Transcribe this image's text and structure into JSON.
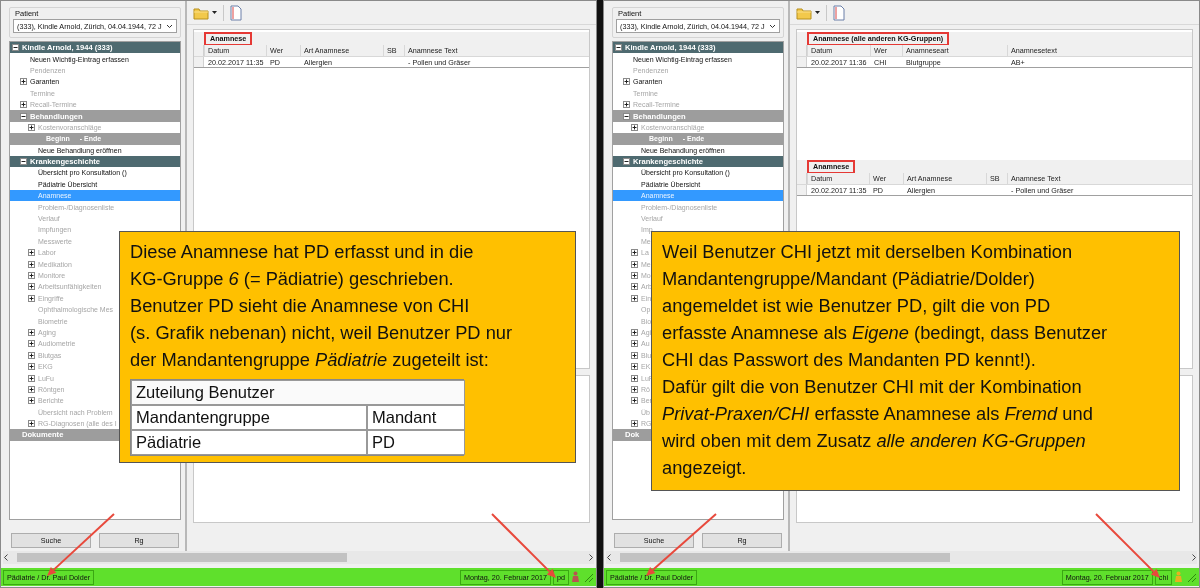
{
  "panels": [
    {
      "patient": {
        "label": "Patient",
        "value": "(333), Kindle Arnold, Zürich, 04.04.1944, 72 J"
      },
      "tree": [
        {
          "kind": "header",
          "label": "Kindle Arnold, 1944 (333)",
          "expanded": true,
          "children": [
            {
              "kind": "item",
              "label": "Neuen Wichtig-Eintrag erfassen",
              "disabled": false,
              "selected": false
            },
            {
              "kind": "item",
              "label": "Pendenzen",
              "disabled": true,
              "selected": false
            },
            {
              "kind": "item",
              "label": "Garanten",
              "disabled": false,
              "selected": false,
              "expanded": false
            },
            {
              "kind": "item",
              "label": "Termine",
              "disabled": true,
              "selected": false
            },
            {
              "kind": "item",
              "label": "Recall-Termine",
              "disabled": true,
              "selected": false,
              "expanded": false
            },
            {
              "kind": "section",
              "label": "Behandlungen",
              "expanded": true,
              "children": [
                {
                  "kind": "item",
                  "label": "Kostenvoranschläge",
                  "disabled": true,
                  "selected": false,
                  "expanded": false
                },
                {
                  "kind": "band",
                  "labels": [
                    "Beginn",
                    "- Ende"
                  ]
                },
                {
                  "kind": "item",
                  "label": "Neue Behandlung eröffnen",
                  "disabled": false,
                  "selected": false
                }
              ]
            },
            {
              "kind": "header",
              "label": "Krankengeschichte",
              "expanded": true,
              "children": [
                {
                  "kind": "item",
                  "label": "Übersicht pro Konsultation ()",
                  "disabled": false,
                  "selected": false
                },
                {
                  "kind": "item",
                  "label": "Pädiatrie Übersicht",
                  "disabled": false,
                  "selected": false
                },
                {
                  "kind": "item",
                  "label": "Anamnese",
                  "disabled": false,
                  "selected": true
                },
                {
                  "kind": "item",
                  "label": "Problem-/Diagnosenliste",
                  "disabled": true,
                  "selected": false
                },
                {
                  "kind": "item",
                  "label": "Verlauf",
                  "disabled": true,
                  "selected": false
                },
                {
                  "kind": "item",
                  "label": "Impfungen",
                  "disabled": true,
                  "selected": false
                },
                {
                  "kind": "item",
                  "label": "Messwerte",
                  "disabled": true,
                  "selected": false
                },
                {
                  "kind": "item",
                  "label": "Labor",
                  "disabled": true,
                  "selected": false,
                  "expanded": false
                },
                {
                  "kind": "item",
                  "label": "Medikation",
                  "disabled": true,
                  "selected": false,
                  "expanded": false
                },
                {
                  "kind": "item",
                  "label": "Monitore",
                  "disabled": true,
                  "selected": false,
                  "expanded": false
                },
                {
                  "kind": "item",
                  "label": "Arbeitsunfähigkeiten",
                  "disabled": true,
                  "selected": false,
                  "expanded": false
                },
                {
                  "kind": "item",
                  "label": "Eingriffe",
                  "disabled": true,
                  "selected": false,
                  "expanded": false
                },
                {
                  "kind": "item",
                  "label": "Ophthalmologische Mes",
                  "disabled": true,
                  "selected": false
                },
                {
                  "kind": "item",
                  "label": "Biometrie",
                  "disabled": true,
                  "selected": false
                },
                {
                  "kind": "item",
                  "label": "Aging",
                  "disabled": true,
                  "selected": false,
                  "expanded": false
                },
                {
                  "kind": "item",
                  "label": "Audiometrie",
                  "disabled": true,
                  "selected": false,
                  "expanded": false
                },
                {
                  "kind": "item",
                  "label": "Blutgas",
                  "disabled": true,
                  "selected": false,
                  "expanded": false
                },
                {
                  "kind": "item",
                  "label": "EKG",
                  "disabled": true,
                  "selected": false,
                  "expanded": false
                },
                {
                  "kind": "item",
                  "label": "LuFu",
                  "disabled": true,
                  "selected": false,
                  "expanded": false
                },
                {
                  "kind": "item",
                  "label": "Röntgen",
                  "disabled": true,
                  "selected": false,
                  "expanded": false
                },
                {
                  "kind": "item",
                  "label": "Berichte",
                  "disabled": true,
                  "selected": false,
                  "expanded": false
                },
                {
                  "kind": "item",
                  "label": "Übersicht nach Problem",
                  "disabled": true,
                  "selected": false
                },
                {
                  "kind": "item",
                  "label": "RG-Diagnosen (alle des I",
                  "disabled": true,
                  "selected": false,
                  "expanded": false
                }
              ]
            }
          ]
        },
        {
          "kind": "section",
          "label": "Dokumente"
        }
      ],
      "buttons": [
        "Suche",
        "Rg"
      ],
      "tables": [
        {
          "caption": "Anamnese",
          "highlighted": true,
          "columns": [
            "Datum",
            "Wer",
            "Art Anamnese",
            "SB",
            "Anamnese Text"
          ],
          "rows": [
            [
              "20.02.2017 11:35",
              "PD",
              "Allergien",
              "",
              "- Pollen und Gräser"
            ]
          ]
        }
      ],
      "status_bar": {
        "text": "Pädiatrie / Dr. Paul Dolder",
        "date": "Montag, 20. Februar 2017",
        "user": "pd",
        "icon": {
          "color": "#b85450"
        }
      },
      "callout": {
        "text": "Diese Anamnese hat PD erfasst und in die\nKG-Gruppe *6* (= Pädiatrie) geschrieben.\nBenutzer PD sieht die Anamnese von CHI\n(s. Grafik nebenan) nicht, weil Benutzer PD nur\nder Mandantengruppe *Pädiatrie* zugeteilt ist:",
        "table": {
          "title": "Zuteilung Benutzer",
          "columns": [
            "Mandantengruppe",
            "Mandant"
          ],
          "rows": [
            [
              "Pädiatrie",
              "PD"
            ]
          ]
        }
      }
    },
    {
      "patient": {
        "label": "Patient",
        "value": "(333), Kindle Arnold, Zürich, 04.04.1944, 72 J"
      },
      "tree": [
        {
          "kind": "header",
          "label": "Kindle Arnold, 1944 (333)",
          "expanded": true,
          "children": [
            {
              "kind": "item",
              "label": "Neuen Wichtig-Eintrag erfassen",
              "disabled": false,
              "selected": false
            },
            {
              "kind": "item",
              "label": "Pendenzen",
              "disabled": true,
              "selected": false
            },
            {
              "kind": "item",
              "label": "Garanten",
              "disabled": false,
              "selected": false,
              "expanded": false
            },
            {
              "kind": "item",
              "label": "Termine",
              "disabled": true,
              "selected": false
            },
            {
              "kind": "item",
              "label": "Recall-Termine",
              "disabled": true,
              "selected": false,
              "expanded": false
            },
            {
              "kind": "section",
              "label": "Behandlungen",
              "expanded": true,
              "children": [
                {
                  "kind": "item",
                  "label": "Kostenvoranschläge",
                  "disabled": true,
                  "selected": false,
                  "expanded": false
                },
                {
                  "kind": "band",
                  "labels": [
                    "Beginn",
                    "- Ende"
                  ]
                },
                {
                  "kind": "item",
                  "label": "Neue Behandlung eröffnen",
                  "disabled": false,
                  "selected": false
                }
              ]
            },
            {
              "kind": "header",
              "label": "Krankengeschichte",
              "expanded": true,
              "children": [
                {
                  "kind": "item",
                  "label": "Übersicht pro Konsultation ()",
                  "disabled": false,
                  "selected": false
                },
                {
                  "kind": "item",
                  "label": "Pädiatrie Übersicht",
                  "disabled": false,
                  "selected": false
                },
                {
                  "kind": "item",
                  "label": "Anamnese",
                  "disabled": false,
                  "selected": true
                },
                {
                  "kind": "item",
                  "label": "Problem-/Diagnosenliste",
                  "disabled": true,
                  "selected": false
                },
                {
                  "kind": "item",
                  "label": "Verlauf",
                  "disabled": true,
                  "selected": false
                },
                {
                  "kind": "item",
                  "label": "Imp",
                  "disabled": true,
                  "selected": false
                },
                {
                  "kind": "item",
                  "label": "Me",
                  "disabled": true,
                  "selected": false
                },
                {
                  "kind": "item",
                  "label": "La",
                  "disabled": true,
                  "selected": false,
                  "expanded": false
                },
                {
                  "kind": "item",
                  "label": "Me",
                  "disabled": true,
                  "selected": false,
                  "expanded": false
                },
                {
                  "kind": "item",
                  "label": "Mo",
                  "disabled": true,
                  "selected": false,
                  "expanded": false
                },
                {
                  "kind": "item",
                  "label": "Arb",
                  "disabled": true,
                  "selected": false,
                  "expanded": false
                },
                {
                  "kind": "item",
                  "label": "Ein",
                  "disabled": true,
                  "selected": false,
                  "expanded": false
                },
                {
                  "kind": "item",
                  "label": "Op",
                  "disabled": true,
                  "selected": false
                },
                {
                  "kind": "item",
                  "label": "Bio",
                  "disabled": true,
                  "selected": false
                },
                {
                  "kind": "item",
                  "label": "Agi",
                  "disabled": true,
                  "selected": false,
                  "expanded": false
                },
                {
                  "kind": "item",
                  "label": "Au",
                  "disabled": true,
                  "selected": false,
                  "expanded": false
                },
                {
                  "kind": "item",
                  "label": "Blu",
                  "disabled": true,
                  "selected": false,
                  "expanded": false
                },
                {
                  "kind": "item",
                  "label": "EK",
                  "disabled": true,
                  "selected": false,
                  "expanded": false
                },
                {
                  "kind": "item",
                  "label": "LuF",
                  "disabled": true,
                  "selected": false,
                  "expanded": false
                },
                {
                  "kind": "item",
                  "label": "Rö",
                  "disabled": true,
                  "selected": false,
                  "expanded": false
                },
                {
                  "kind": "item",
                  "label": "Ber",
                  "disabled": true,
                  "selected": false,
                  "expanded": false
                },
                {
                  "kind": "item",
                  "label": "Üb",
                  "disabled": true,
                  "selected": false
                },
                {
                  "kind": "item",
                  "label": "RG",
                  "disabled": true,
                  "selected": false,
                  "expanded": false
                }
              ]
            }
          ]
        },
        {
          "kind": "section",
          "label": "Dok"
        }
      ],
      "buttons": [
        "Suche",
        "Rg"
      ],
      "tables": [
        {
          "caption": "Anamnese (alle anderen KG-Gruppen)",
          "highlighted": true,
          "columns": [
            "Datum",
            "Wer",
            "Anamneseart",
            "Anamnesetext"
          ],
          "rows": [
            [
              "20.02.2017 11:36",
              "CHI",
              "Blutgruppe",
              "AB+"
            ]
          ]
        },
        {
          "caption": "Anamnese",
          "highlighted": true,
          "columns": [
            "Datum",
            "Wer",
            "Art Anamnese",
            "SB",
            "Anamnese Text"
          ],
          "rows": [
            [
              "20.02.2017 11:35",
              "PD",
              "Allergien",
              "",
              "- Pollen und Gräser"
            ]
          ]
        }
      ],
      "status_bar": {
        "text": "Pädiatrie / Dr. Paul Dolder",
        "date": "Montag, 20. Februar 2017",
        "user": "chi",
        "icon": {
          "color": "#e8b020"
        }
      },
      "callout": {
        "text": "Weil Benutzer CHI jetzt mit derselben Kombination\nMandantengruppe/Mandant (Pädiatrie/Dolder)\nangemeldet ist wie Benutzer PD, gilt die von PD\nerfasste Anamnese als *Eigene* (bedingt, dass Benutzer\nCHI das Passwort des Mandanten PD kennt!).\nDafür gilt die von Benutzer CHI mit der Kombination\n*Privat-Praxen/CHI* erfasste Anamnese als *Fremd* und\nwird oben mit dem Zusatz *alle anderen KG-Gruppen*\nangezeigt."
      }
    }
  ]
}
